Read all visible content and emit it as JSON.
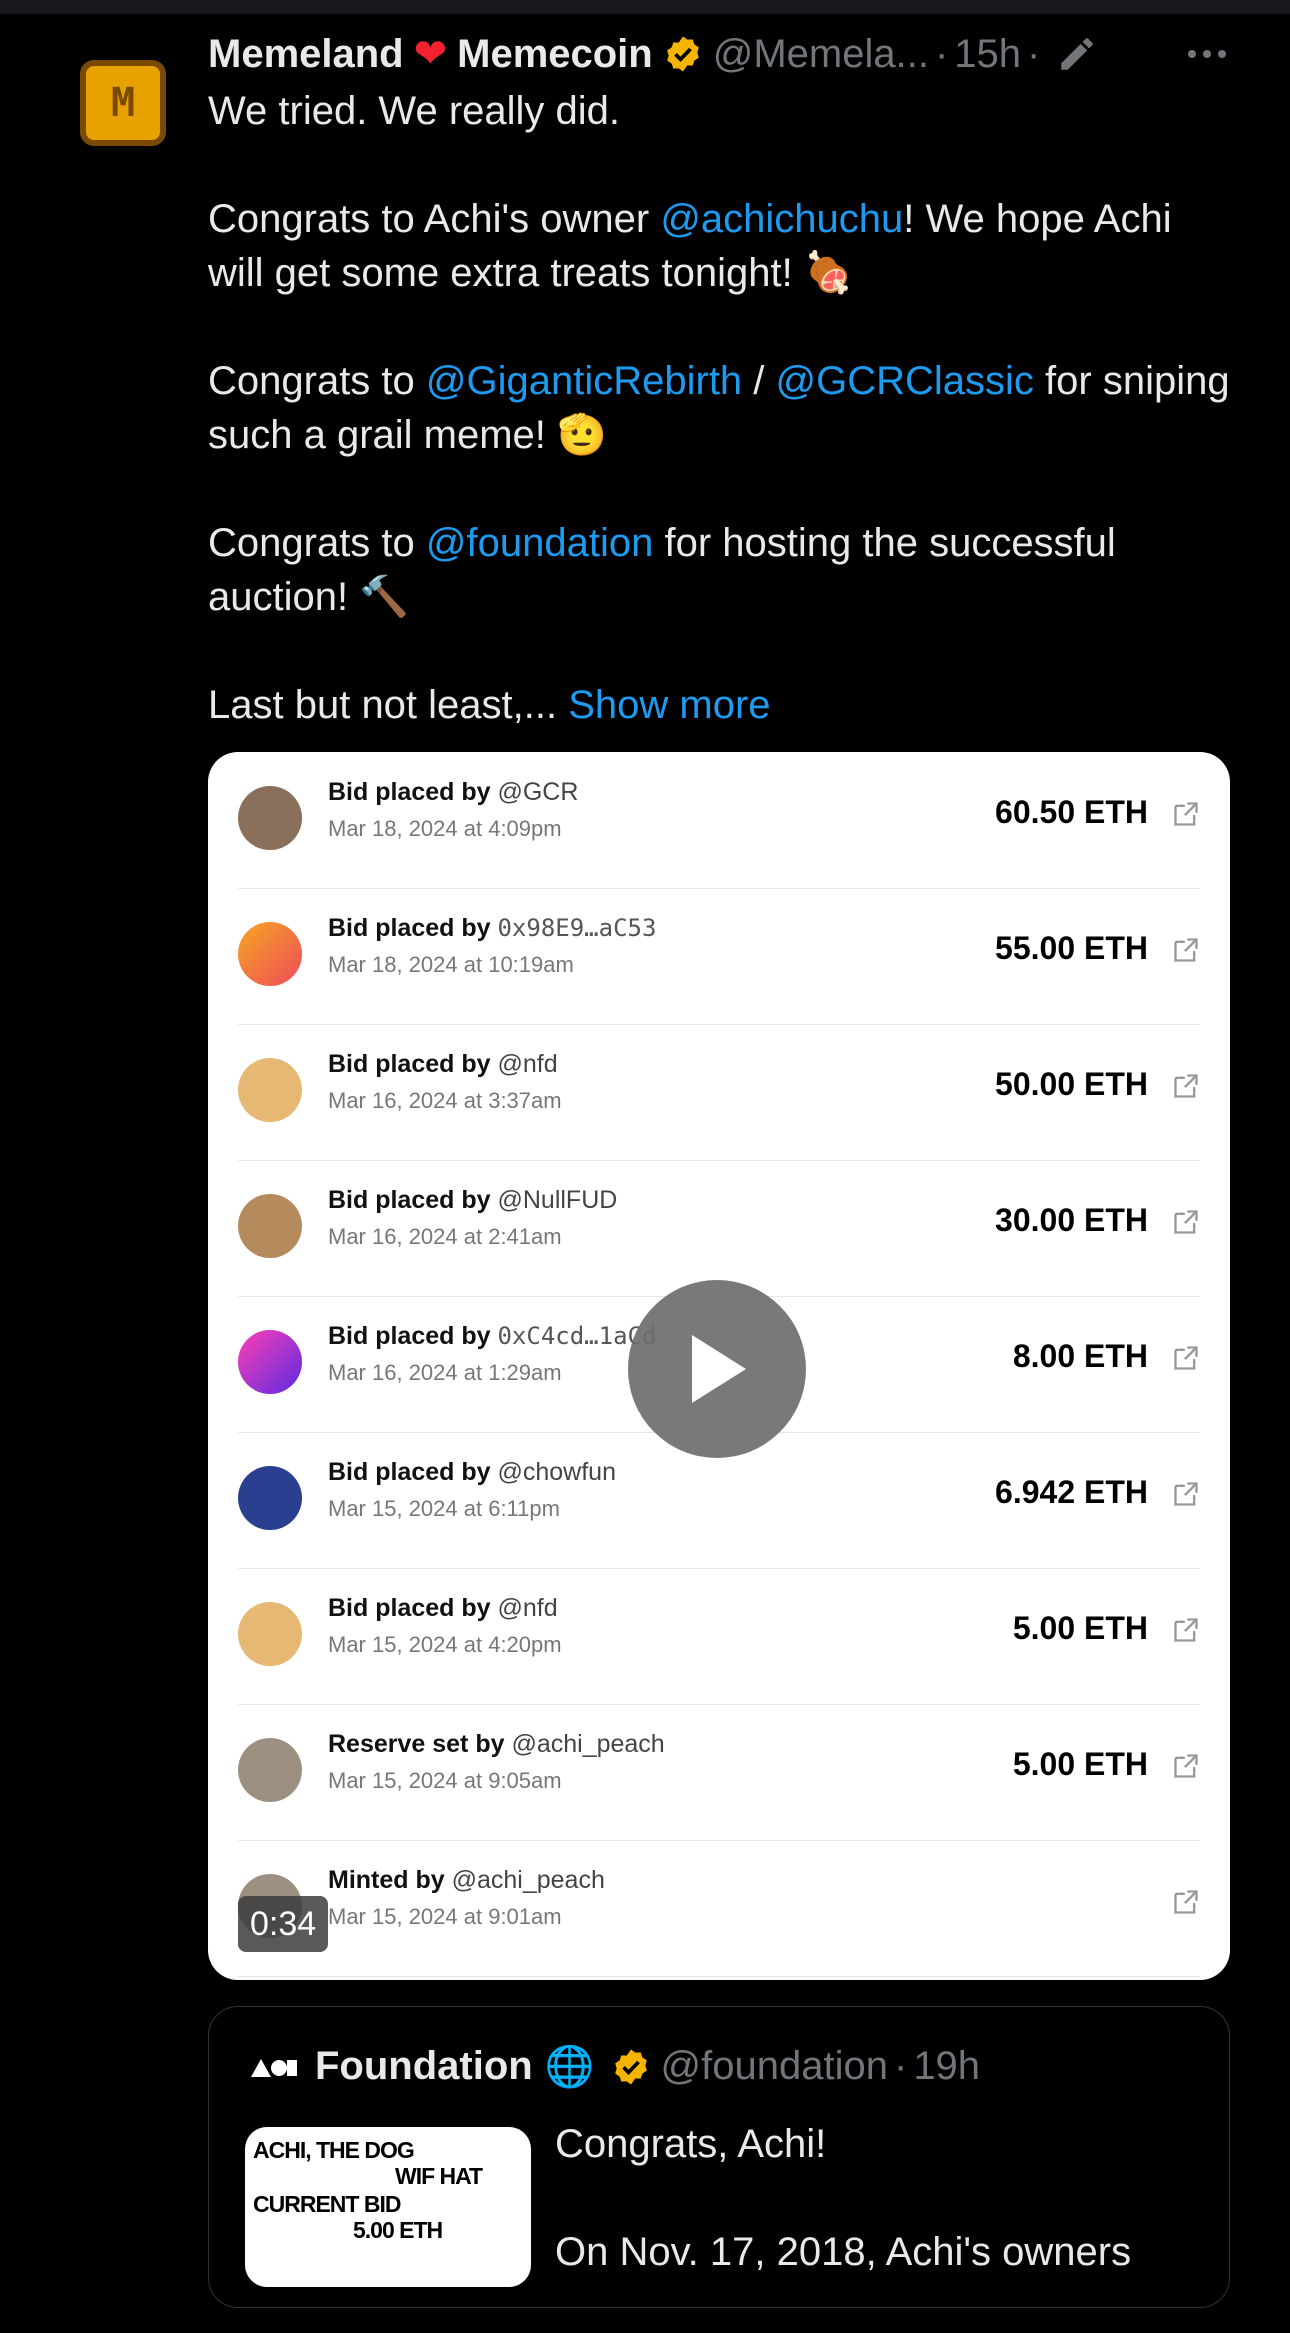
{
  "post": {
    "display_name_1": "Memeland",
    "display_name_2": "Memecoin",
    "handle": "@Memela...",
    "time": "15h",
    "dot": "·",
    "paragraphs": {
      "p1": "We tried. We really did.",
      "p2a": "Congrats to Achi's owner ",
      "p2_mention": "@achichuchu",
      "p2b": "! We hope Achi will get some extra treats tonight! 🍖",
      "p3a": "Congrats to ",
      "p3_mention1": "@GiganticRebirth",
      "p3_sep": " / ",
      "p3_mention2": "@GCRClassic",
      "p3b": " for sniping such a grail meme! 🫡",
      "p4a": "Congrats to ",
      "p4_mention": "@foundation",
      "p4b": " for hosting the successful auction! 🔨",
      "p5": "Last but not least,... ",
      "show_more": "Show more"
    }
  },
  "media": {
    "duration": "0:34",
    "rows": [
      {
        "label": "Bid placed by ",
        "who": "@GCR",
        "mono": false,
        "date": "Mar 18, 2024 at 4:09pm",
        "amount": "60.50 ETH",
        "avatar_color": "#8a6f5a"
      },
      {
        "label": "Bid placed by ",
        "who": "0x98E9…aC53",
        "mono": true,
        "date": "Mar 18, 2024 at 10:19am",
        "amount": "55.00 ETH",
        "avatar_color": "#f0643c"
      },
      {
        "label": "Bid placed by ",
        "who": "@nfd",
        "mono": false,
        "date": "Mar 16, 2024 at 3:37am",
        "amount": "50.00 ETH",
        "avatar_color": "#e6b874"
      },
      {
        "label": "Bid placed by ",
        "who": "@NullFUD",
        "mono": false,
        "date": "Mar 16, 2024 at 2:41am",
        "amount": "30.00 ETH",
        "avatar_color": "#b58a5c"
      },
      {
        "label": "Bid placed by ",
        "who": "0xC4cd…1aCd",
        "mono": true,
        "date": "Mar 16, 2024 at 1:29am",
        "amount": "8.00 ETH",
        "avatar_color": "#8a2be2"
      },
      {
        "label": "Bid placed by ",
        "who": "@chowfun",
        "mono": false,
        "date": "Mar 15, 2024 at 6:11pm",
        "amount": "6.942 ETH",
        "avatar_color": "#2a3f8f"
      },
      {
        "label": "Bid placed by ",
        "who": "@nfd",
        "mono": false,
        "date": "Mar 15, 2024 at 4:20pm",
        "amount": "5.00 ETH",
        "avatar_color": "#e6b874"
      },
      {
        "label": "Reserve set by ",
        "who": "@achi_peach",
        "mono": false,
        "date": "Mar 15, 2024 at 9:05am",
        "amount": "5.00 ETH",
        "avatar_color": "#9c8f80"
      },
      {
        "label": "Minted by ",
        "who": "@achi_peach",
        "mono": false,
        "date": "Mar 15, 2024 at 9:01am",
        "amount": "",
        "avatar_color": "#9c8f80"
      }
    ]
  },
  "quote": {
    "display_name": "Foundation",
    "handle": "@foundation",
    "dot": "·",
    "time": "19h",
    "text_1": "Congrats, Achi!",
    "text_2": "On Nov. 17, 2018, Achi's owners",
    "thumb": {
      "line1": "ACHI, THE DOG",
      "line2": "WIF HAT",
      "line3": "CURRENT BID",
      "line4": "5.00 ETH"
    }
  },
  "colors": {
    "background": "#000000",
    "link": "#1d9bf0",
    "muted": "#71767b",
    "verified": "#f4b400"
  },
  "icons": [
    "heart-icon",
    "verified-badge-icon",
    "edit-pencil-icon",
    "more-icon",
    "external-link-icon",
    "play-icon",
    "globe-icon",
    "foundation-logo-icon"
  ]
}
